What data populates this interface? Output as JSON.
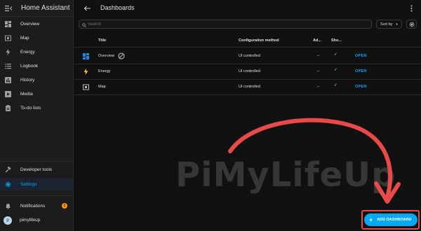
{
  "app": {
    "title": "Home Assistant"
  },
  "sidebar": {
    "items": [
      {
        "label": "Overview",
        "icon": "view-dashboard-icon"
      },
      {
        "label": "Map",
        "icon": "map-icon"
      },
      {
        "label": "Energy",
        "icon": "lightning-bolt-icon"
      },
      {
        "label": "Logbook",
        "icon": "format-list-icon"
      },
      {
        "label": "History",
        "icon": "chart-box-icon"
      },
      {
        "label": "Media",
        "icon": "play-box-icon"
      },
      {
        "label": "To-do lists",
        "icon": "clipboard-list-icon"
      }
    ],
    "bottom": {
      "developer_tools": "Developer tools",
      "settings": "Settings",
      "notifications": "Notifications",
      "notifications_count": "1",
      "user": "pimylifeup",
      "user_initial": "p"
    }
  },
  "header": {
    "title": "Dashboards"
  },
  "search": {
    "placeholder": "Search"
  },
  "sort": {
    "label": "Sort by"
  },
  "table": {
    "columns": [
      "Title",
      "Configuration method",
      "Ad...",
      "Sho..."
    ],
    "rows": [
      {
        "title": "Overview",
        "method": "UI controlled",
        "admin": "–",
        "show": "✓",
        "action": "OPEN"
      },
      {
        "title": "Energy",
        "method": "UI controlled",
        "admin": "–",
        "show": "✓",
        "action": "OPEN"
      },
      {
        "title": "Map",
        "method": "UI controlled",
        "admin": "–",
        "show": "✓",
        "action": "OPEN"
      }
    ]
  },
  "watermark": {
    "text": "PiMyLifeUp"
  },
  "fab": {
    "label": "ADD DASHBOARD"
  },
  "colors": {
    "accent": "#03a9f4",
    "annotation": "#e84a4a",
    "badge": "#ff9800"
  }
}
